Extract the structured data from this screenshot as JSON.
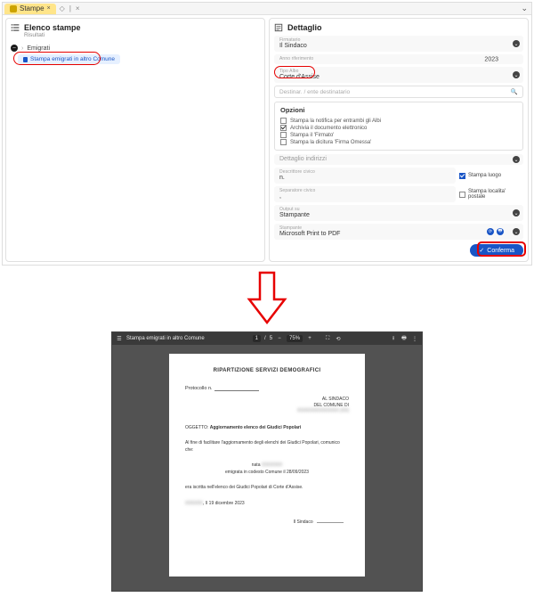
{
  "tab": {
    "title": "Stampe",
    "close": "×"
  },
  "left": {
    "title": "Elenco stampe",
    "subtitle": "Risultati",
    "crumb": "Emigrati",
    "selected": "Stampa emigrati in altro Comune"
  },
  "right": {
    "title": "Dettaglio",
    "fields": {
      "firmatario_lbl": "Firmatario",
      "firmatario_val": "Il Sindaco",
      "anno_lbl": "Anno riferimento",
      "anno_val": "2023",
      "tipoalbo_lbl": "Tipo Albo",
      "tipoalbo_val": "Corte d'Assise",
      "search_ph": "Destinar. / ente destinatario"
    },
    "opzioni": {
      "title": "Opzioni",
      "o1": "Stampa la notifica per entrambi gli Albi",
      "o2": "Archivia il documento elettronico",
      "o3": "Stampa il 'Firmato'",
      "o4": "Stampa la dicitura 'Firma Omessa'"
    },
    "dettaglio_ind": "Dettaglio indirizzi",
    "descr": {
      "lbl": "Descrittore civico",
      "val": "n."
    },
    "stampa_luogo": "Stampa luogo",
    "sep": {
      "lbl": "Separatore civico",
      "val": ","
    },
    "loc_postale": "Stampa localita' postale",
    "output_lbl": "Output su",
    "output_val": "Stampante",
    "stampante_lbl": "Stampante",
    "stampante_val": "Microsoft Print to PDF",
    "confirm": "Conferma"
  },
  "pdf": {
    "name": "Stampa emigrati in altro Comune",
    "page": "1",
    "total": "5",
    "zoom": "75%",
    "doc": {
      "heading": "RIPARTIZIONE SERVIZI DEMOGRAFICI",
      "protocollo": "Protocollo n.",
      "dest1": "AL SINDACO",
      "dest2": "DEL COMUNE DI",
      "oggetto_lbl": "OGGETTO:",
      "oggetto_val": "Aggiornamento elenco dei Giudici Popolari",
      "body1": "Al fine di facilitare l'aggiornamento degli elenchi dei Giudici Popolari, comunico che:",
      "body2": "emigrata in codesto Comune il 28/09/2023",
      "body3": "era iscritta nell'elenco dei Giudici Popolari di Corte d'Assise.",
      "date_line": "lì 19 dicembre 2023",
      "sig": "Il Sindaco"
    }
  }
}
